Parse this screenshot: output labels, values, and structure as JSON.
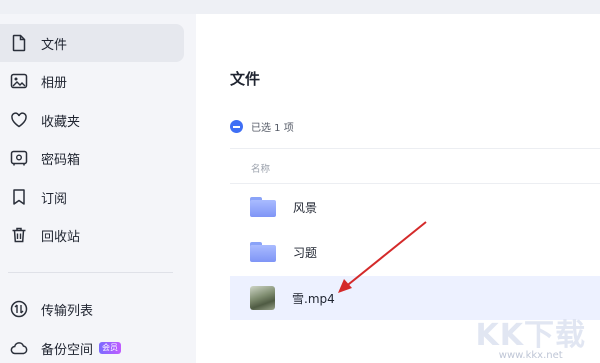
{
  "sidebar": {
    "items": [
      {
        "label": "文件",
        "icon": "file-icon"
      },
      {
        "label": "相册",
        "icon": "photo-album-icon"
      },
      {
        "label": "收藏夹",
        "icon": "heart-icon"
      },
      {
        "label": "密码箱",
        "icon": "safe-box-icon"
      },
      {
        "label": "订阅",
        "icon": "bookmark-icon"
      },
      {
        "label": "回收站",
        "icon": "trash-icon"
      }
    ],
    "lower_items": [
      {
        "label": "传输列表",
        "icon": "transfer-icon"
      },
      {
        "label": "备份空间",
        "icon": "cloud-icon",
        "badge": "会员"
      }
    ]
  },
  "main": {
    "title": "文件",
    "selection_text": "已选 1 项",
    "column_name": "名称",
    "files": [
      {
        "name": "风景",
        "type": "folder"
      },
      {
        "name": "习题",
        "type": "folder"
      },
      {
        "name": "雪.mp4",
        "type": "video"
      }
    ]
  },
  "watermark": {
    "logo": "KK下载",
    "url": "www.kkx.net"
  },
  "colors": {
    "accent": "#3f6ff5",
    "selected_row": "#edf1ff",
    "sidebar_bg": "#f4f5f9",
    "arrow": "#d42a2a"
  }
}
